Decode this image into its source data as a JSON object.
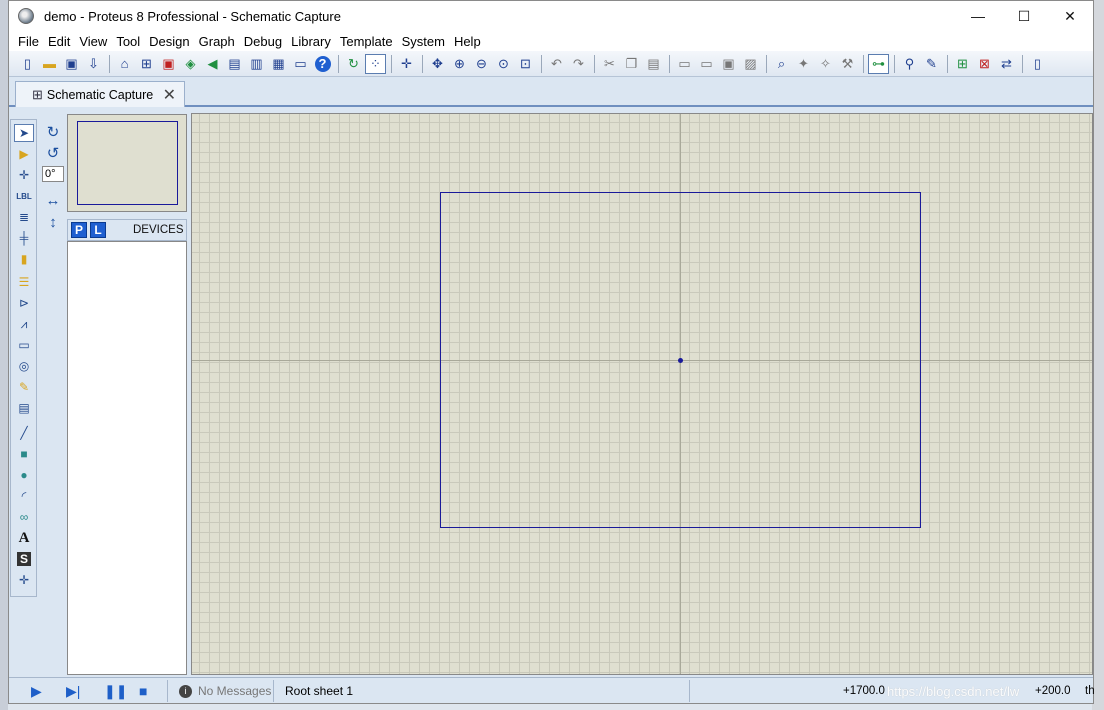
{
  "title_bar": {
    "title": "demo - Proteus 8 Professional - Schematic Capture",
    "minimize": "—",
    "maximize": "☐",
    "close": "✕"
  },
  "menu": [
    "File",
    "Edit",
    "View",
    "Tool",
    "Design",
    "Graph",
    "Debug",
    "Library",
    "Template",
    "System",
    "Help"
  ],
  "toolbar_icons": [
    "new-file",
    "open-folder",
    "save",
    "import",
    "home",
    "schematic",
    "pcb",
    "3d-viewer",
    "gerber",
    "bom",
    "design-explorer",
    "simulation-graph",
    "notes",
    "help",
    "refresh",
    "grid",
    "origin",
    "pan",
    "zoom-in",
    "zoom-out",
    "zoom-all",
    "zoom-area",
    "undo",
    "redo",
    "cut",
    "copy",
    "paste",
    "block-copy",
    "block-move",
    "block-rotate",
    "block-delete",
    "pick-device",
    "make-device",
    "packaging",
    "decompose",
    "wire-autorouter",
    "search",
    "property-assignment",
    "new-sheet",
    "remove-sheet",
    "navigate",
    "netlist-to-pcb"
  ],
  "tab": {
    "label": "Schematic Capture",
    "close": "✕"
  },
  "left_tools": [
    "selection-mode",
    "component-mode",
    "junction-dot",
    "wire-label",
    "text-script",
    "buses",
    "subcircuit",
    "terminals",
    "device-pins",
    "graph",
    "tape-recorder",
    "generator",
    "voltage-probe",
    "virtual-instruments",
    "line-2d",
    "box-2d",
    "circle-2d",
    "arc-2d",
    "closed-path-2d",
    "text-2d",
    "symbols",
    "markers"
  ],
  "rotation": {
    "angle": "0°"
  },
  "devices": {
    "p_label": "P",
    "l_label": "L",
    "header": "DEVICES"
  },
  "status": {
    "messages": "No Messages",
    "sheet": "Root sheet 1",
    "x_coord": "+1700.0",
    "y_coord": "+200.0",
    "unit": "th",
    "watermark": "https://blog.csdn.net/lw"
  }
}
